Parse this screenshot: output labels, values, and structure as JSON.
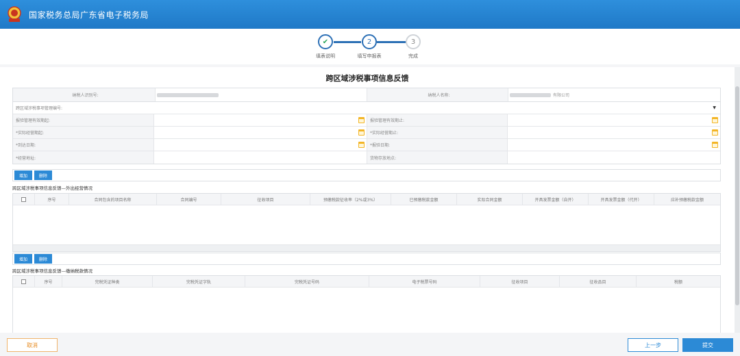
{
  "header": {
    "title": "国家税务总局广东省电子税务局"
  },
  "steps": [
    {
      "label": "填表说明",
      "num": "✔",
      "state": "done"
    },
    {
      "label": "填写申报表",
      "num": "2",
      "state": "active"
    },
    {
      "label": "完成",
      "num": "3",
      "state": "todo"
    }
  ],
  "form": {
    "title": "跨区域涉税事项信息反馈",
    "fields": {
      "taxpayer_id_label": "纳税人识别号:",
      "taxpayer_name_label": "纳税人名称:",
      "taxpayer_name_suffix": "有限公司",
      "cross_region_id_label": "跨区域涉税事项管理编号:",
      "valid_start_label": "报验管理有效期起:",
      "valid_end_label": "报验管理有效期止:",
      "actual_start_label": "*实际经营期起:",
      "actual_end_label": "*实际经营期止:",
      "return_date_label": "*到达日期:",
      "report_date_label": "*报验日期:",
      "biz_addr_label": "*经营地址:",
      "storage_label": "货物存放地点:"
    }
  },
  "section1": {
    "add_label": "增加",
    "delete_label": "删除",
    "title": "跨区域涉税事项信息反馈—外出经营情况",
    "columns": [
      "序号",
      "合同包含的项目名称",
      "合同编号",
      "征收项目",
      "预缴税款征收率（2%或3%）",
      "已预缴税款金额",
      "实际合同金额",
      "开具发票金额（自开）",
      "开具发票金额（代开）",
      "应补预缴税款金额"
    ]
  },
  "section2": {
    "add_label": "增加",
    "delete_label": "删除",
    "title": "跨区域涉税事项信息反馈—缴纳税款情况",
    "columns": [
      "序号",
      "完税凭证种类",
      "完税凭证字轨",
      "完税凭证号码",
      "电子税票号码",
      "征收项目",
      "征收品目",
      "税额"
    ]
  },
  "footer": {
    "cancel_label": "取消",
    "prev_label": "上一步",
    "submit_label": "提交"
  },
  "colors": {
    "primary": "#2c8ad6",
    "header": "#1f79c7",
    "cancel": "#e68a1f",
    "calendar": "#f3b526"
  }
}
